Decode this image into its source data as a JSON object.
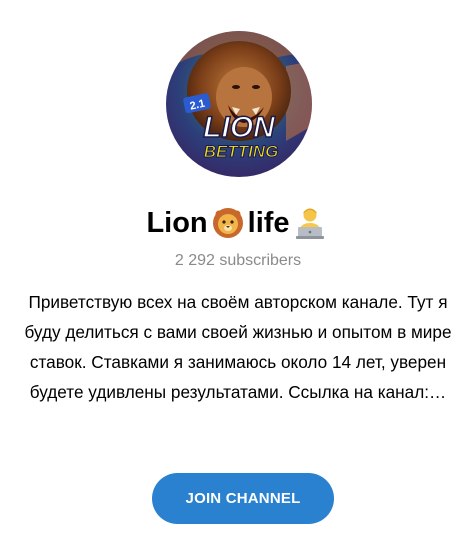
{
  "channel": {
    "name_part1": "Lion",
    "name_part2": "life",
    "subscribers": "2 292 subscribers",
    "description": "Приветствую всех на своём авторском канале. Тут я буду делиться с вами своей жизнью и опытом в мире ставок. Ставками я занимаюсь около 14 лет, уверен будете удивлены результатами. Ссылка на канал:…",
    "avatar_text_line1": "LION",
    "avatar_text_line2": "BETTING",
    "avatar_badge": "2.1"
  },
  "icons": {
    "name_emoji_1": "lion-face-emoji",
    "name_emoji_2": "technologist-emoji"
  },
  "actions": {
    "join_label": "JOIN CHANNEL"
  },
  "colors": {
    "button": "#2a81cf",
    "subscribers_text": "#8a8a8a",
    "avatar_badge_yellow": "#f3e21a"
  }
}
